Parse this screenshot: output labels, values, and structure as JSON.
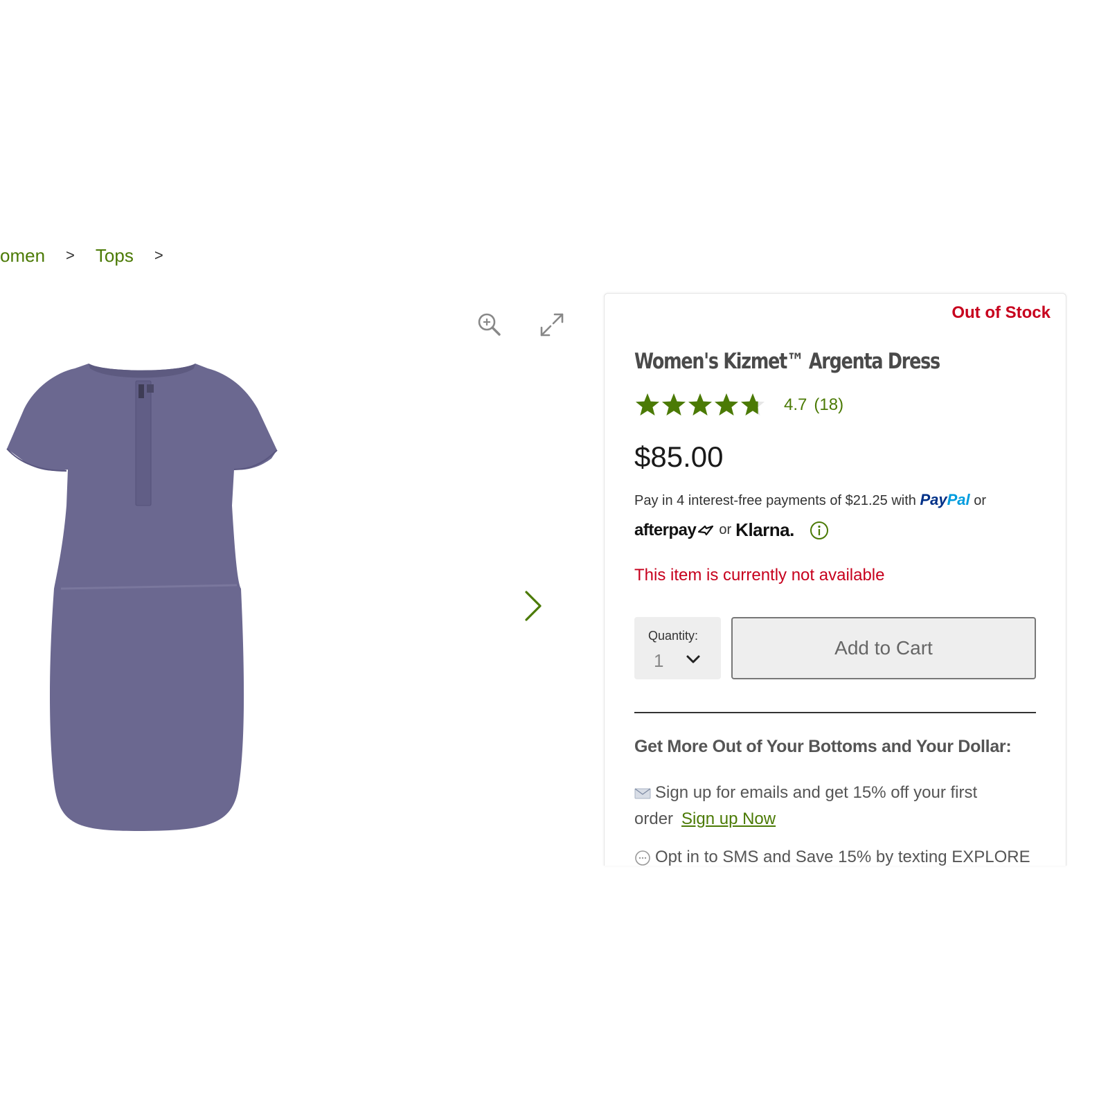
{
  "breadcrumb": {
    "items": [
      {
        "label": "omen"
      },
      {
        "label": "Tops"
      }
    ],
    "separator": ">"
  },
  "gallery": {
    "zoom_icon": "zoom-in-icon",
    "expand_icon": "expand-icon",
    "next_icon": "chevron-right-icon",
    "image_alt": "Women's Kizmet Argenta Dress"
  },
  "product": {
    "stock_status": "Out of Stock",
    "title": "Women's Kizmet™ Argenta Dress",
    "rating": "4.7",
    "rating_value": 4.7,
    "rating_max": 5,
    "review_count": "(18)",
    "price": "$85.00",
    "payment": {
      "line_prefix": "Pay in 4 interest-free payments of $21.25 with",
      "paypal_pay": "Pay",
      "paypal_pal": "Pal",
      "or_1": "or",
      "afterpay": "afterpay",
      "or_2": "or",
      "klarna": "Klarna."
    },
    "availability": "This item is currently not available",
    "quantity_label": "Quantity:",
    "quantity_value": "1",
    "add_to_cart_label": "Add to Cart"
  },
  "promo": {
    "heading": "Get More Out of Your Bottoms and Your Dollar:",
    "email_text": "Sign up for emails and get 15% off your first order",
    "email_link": "Sign up Now",
    "sms_text": "Opt in to SMS and Save 15% by texting EXPLORE"
  },
  "colors": {
    "accent_green": "#4b7a05",
    "alert_red": "#c7001d",
    "dress": "#6b6890"
  }
}
